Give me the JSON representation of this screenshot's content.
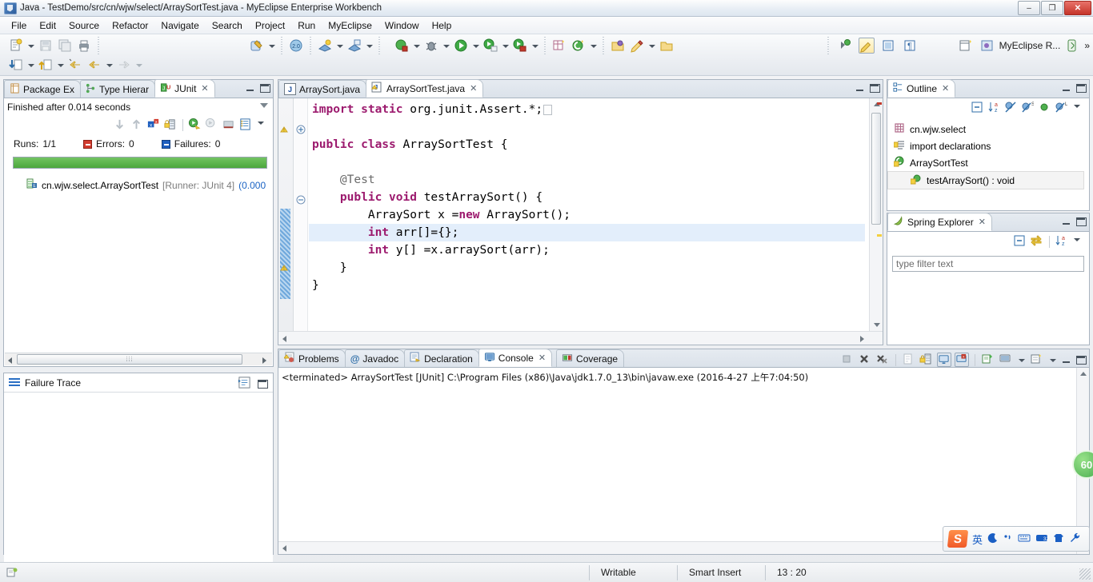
{
  "window": {
    "title": "Java - TestDemo/src/cn/wjw/select/ArraySortTest.java - MyEclipse Enterprise Workbench",
    "icon": "myeclipse-icon",
    "minimize": "–",
    "maximize": "❐",
    "close": "✕"
  },
  "menubar": {
    "items": [
      {
        "label": "File"
      },
      {
        "label": "Edit"
      },
      {
        "label": "Source"
      },
      {
        "label": "Refactor"
      },
      {
        "label": "Navigate"
      },
      {
        "label": "Search"
      },
      {
        "label": "Project"
      },
      {
        "label": "Run"
      },
      {
        "label": "MyEclipse"
      },
      {
        "label": "Window"
      },
      {
        "label": "Help"
      }
    ]
  },
  "toolbar": {
    "perspective_label": "MyEclipse R...",
    "overflow": "»"
  },
  "junit": {
    "tabs": [
      {
        "label": "Package Ex",
        "icon": "package-explorer-icon",
        "active": false
      },
      {
        "label": "Type Hierar",
        "icon": "type-hierarchy-icon",
        "active": false
      },
      {
        "label": "JUnit",
        "icon": "junit-icon",
        "active": true,
        "close": "✕"
      }
    ],
    "status": "Finished after 0.014 seconds",
    "runs_label": "Runs:",
    "runs_value": "1/1",
    "errors_label": "Errors:",
    "errors_value": "0",
    "failures_label": "Failures:",
    "failures_value": "0",
    "progress_percent": 100,
    "progress_color": "#4ba73d",
    "tree": [
      {
        "name": "cn.wjw.select.ArraySortTest",
        "runner": "[Runner: JUnit 4]",
        "time": "(0.000",
        "icon": "test-suite-pass-icon"
      }
    ]
  },
  "failure_trace": {
    "title": "Failure Trace",
    "icon": "failure-trace-icon",
    "content": ""
  },
  "editor": {
    "tabs": [
      {
        "label": "ArraySort.java",
        "icon": "java-file-icon",
        "active": false
      },
      {
        "label": "ArraySortTest.java",
        "icon": "java-file-warning-icon",
        "active": true,
        "close": "✕"
      }
    ],
    "lines": [
      {
        "indent": 0,
        "tokens": [
          {
            "t": "import ",
            "c": "kw"
          },
          {
            "t": "static ",
            "c": "kw"
          },
          {
            "t": "org.junit.Assert.*;",
            "c": "txt"
          }
        ],
        "highlight": false,
        "fold": "plus"
      },
      {
        "indent": 0,
        "tokens": [],
        "highlight": false
      },
      {
        "indent": 0,
        "tokens": [
          {
            "t": "public ",
            "c": "kw"
          },
          {
            "t": "class ",
            "c": "kw"
          },
          {
            "t": "ArraySortTest {",
            "c": "txt"
          }
        ],
        "highlight": false
      },
      {
        "indent": 0,
        "tokens": [],
        "highlight": false
      },
      {
        "indent": 1,
        "tokens": [
          {
            "t": "@Test",
            "c": "ann"
          }
        ],
        "highlight": false,
        "fold": "minus"
      },
      {
        "indent": 1,
        "tokens": [
          {
            "t": "public ",
            "c": "kw"
          },
          {
            "t": "void ",
            "c": "kw"
          },
          {
            "t": "testArraySort() {",
            "c": "txt"
          }
        ],
        "highlight": false
      },
      {
        "indent": 2,
        "tokens": [
          {
            "t": "ArraySort x =",
            "c": "txt"
          },
          {
            "t": "new ",
            "c": "kw"
          },
          {
            "t": "ArraySort();",
            "c": "txt"
          }
        ],
        "highlight": false
      },
      {
        "indent": 2,
        "tokens": [
          {
            "t": "int ",
            "c": "kw"
          },
          {
            "t": "arr[]={};",
            "c": "txt"
          }
        ],
        "highlight": true
      },
      {
        "indent": 2,
        "tokens": [
          {
            "t": "int ",
            "c": "kw"
          },
          {
            "t": "y[] =x.arraySort(arr);",
            "c": "txt"
          }
        ],
        "highlight": false
      },
      {
        "indent": 1,
        "tokens": [
          {
            "t": "}",
            "c": "txt"
          }
        ],
        "highlight": false
      },
      {
        "indent": 0,
        "tokens": [
          {
            "t": "}",
            "c": "txt"
          }
        ],
        "highlight": false
      }
    ]
  },
  "outline": {
    "tabs": [
      {
        "label": "Outline",
        "icon": "outline-icon",
        "active": true,
        "close": "✕"
      }
    ],
    "items": [
      {
        "label": "cn.wjw.select",
        "icon": "package-icon",
        "indent": 0,
        "selected": false
      },
      {
        "label": "import declarations",
        "icon": "import-declarations-icon",
        "indent": 0,
        "selected": false
      },
      {
        "label": "ArraySortTest",
        "icon": "class-icon",
        "indent": 0,
        "selected": false
      },
      {
        "label": "testArraySort() : void",
        "icon": "method-icon",
        "indent": 1,
        "selected": true
      }
    ]
  },
  "spring": {
    "tabs": [
      {
        "label": "Spring Explorer",
        "icon": "spring-icon",
        "active": true,
        "close": "✕"
      }
    ],
    "filter_placeholder": "type filter text",
    "filter_value": ""
  },
  "console": {
    "tabs": [
      {
        "label": "Problems",
        "icon": "problems-icon",
        "active": false
      },
      {
        "label": "Javadoc",
        "icon": "javadoc-icon",
        "active": false
      },
      {
        "label": "Declaration",
        "icon": "declaration-icon",
        "active": false
      },
      {
        "label": "Console",
        "icon": "console-icon",
        "active": true,
        "close": "✕"
      },
      {
        "label": "Coverage",
        "icon": "coverage-icon",
        "active": false
      }
    ],
    "output": "<terminated> ArraySortTest [JUnit] C:\\Program Files (x86)\\Java\\jdk1.7.0_13\\bin\\javaw.exe (2016-4-27 上午7:04:50)"
  },
  "statusbar": {
    "writable": "Writable",
    "insert_mode": "Smart Insert",
    "position": "13 : 20"
  },
  "ime": {
    "logo": "S",
    "mode": "英",
    "items": [
      "moon-icon",
      "comma-icon",
      "keyboard-icon",
      "tools-icon",
      "skin-icon",
      "wrench-icon"
    ]
  },
  "badge": {
    "label": "60"
  }
}
